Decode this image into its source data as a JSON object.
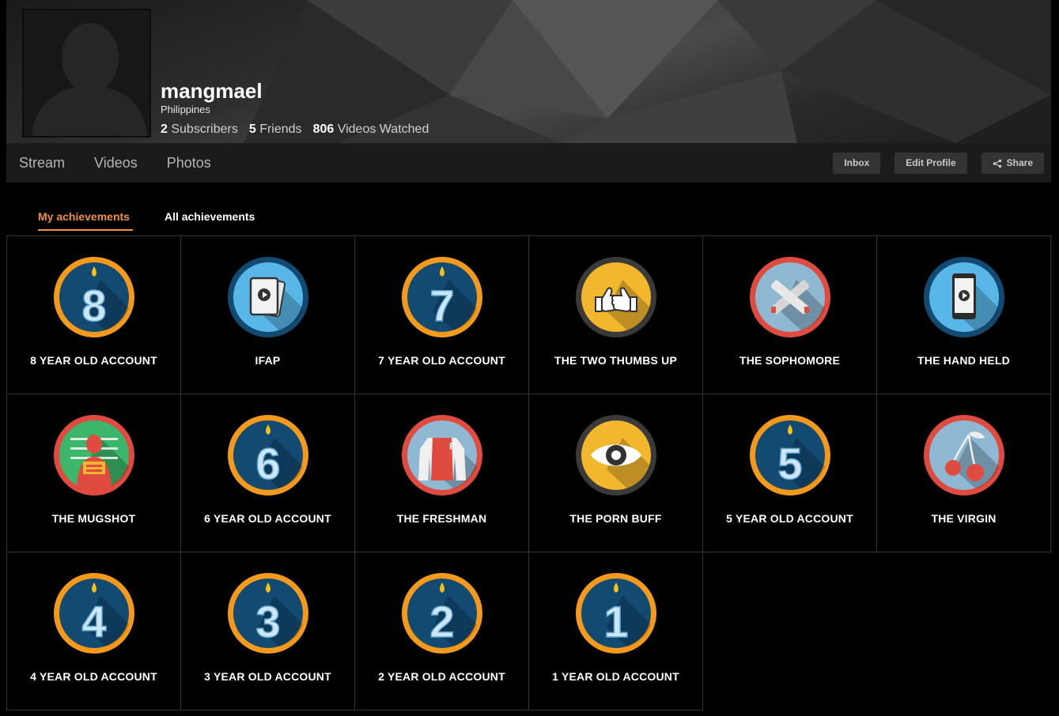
{
  "profile": {
    "username": "mangmael",
    "location": "Philippines",
    "subscribers_count": "2",
    "subscribers_label": "Subscribers",
    "friends_count": "5",
    "friends_label": "Friends",
    "videos_count": "806",
    "videos_label": "Videos Watched"
  },
  "nav": {
    "links": [
      "Stream",
      "Videos",
      "Photos"
    ],
    "inbox": "Inbox",
    "edit_profile": "Edit Profile",
    "share": "Share"
  },
  "tabs": {
    "my": "My achievements",
    "all": "All achievements"
  },
  "achievements": [
    {
      "label": "8 YEAR OLD ACCOUNT",
      "icon": "candle-number-8-icon",
      "kind": "year",
      "num": "8"
    },
    {
      "label": "IFAP",
      "icon": "tablet-video-icon",
      "kind": "tablet"
    },
    {
      "label": "7 YEAR OLD ACCOUNT",
      "icon": "candle-number-7-icon",
      "kind": "year",
      "num": "7"
    },
    {
      "label": "THE TWO THUMBS UP",
      "icon": "two-thumbs-up-icon",
      "kind": "thumbs"
    },
    {
      "label": "THE SOPHOMORE",
      "icon": "crossed-bones-icon",
      "kind": "sophomore"
    },
    {
      "label": "THE HAND HELD",
      "icon": "phone-video-icon",
      "kind": "phone"
    },
    {
      "label": "THE MUGSHOT",
      "icon": "mugshot-icon",
      "kind": "mugshot"
    },
    {
      "label": "6 YEAR OLD ACCOUNT",
      "icon": "candle-number-6-icon",
      "kind": "year",
      "num": "6"
    },
    {
      "label": "THE FRESHMAN",
      "icon": "varsity-jacket-icon",
      "kind": "freshman"
    },
    {
      "label": "THE PORN BUFF",
      "icon": "eye-icon",
      "kind": "eye"
    },
    {
      "label": "5 YEAR OLD ACCOUNT",
      "icon": "candle-number-5-icon",
      "kind": "year",
      "num": "5"
    },
    {
      "label": "THE VIRGIN",
      "icon": "cherries-icon",
      "kind": "cherries"
    },
    {
      "label": "4 YEAR OLD ACCOUNT",
      "icon": "candle-number-4-icon",
      "kind": "year",
      "num": "4"
    },
    {
      "label": "3 YEAR OLD ACCOUNT",
      "icon": "candle-number-3-icon",
      "kind": "year",
      "num": "3"
    },
    {
      "label": "2 YEAR OLD ACCOUNT",
      "icon": "candle-number-2-icon",
      "kind": "year",
      "num": "2"
    },
    {
      "label": "1 YEAR OLD ACCOUNT",
      "icon": "candle-number-1-icon",
      "kind": "year",
      "num": "1"
    }
  ],
  "colors": {
    "accent": "#f0913b",
    "badge_orange": "#f39a1d",
    "badge_red": "#e04b3f",
    "badge_dark": "#3a3a3a",
    "badge_navy": "#134a72",
    "badge_light_blue": "#58b7e6"
  }
}
